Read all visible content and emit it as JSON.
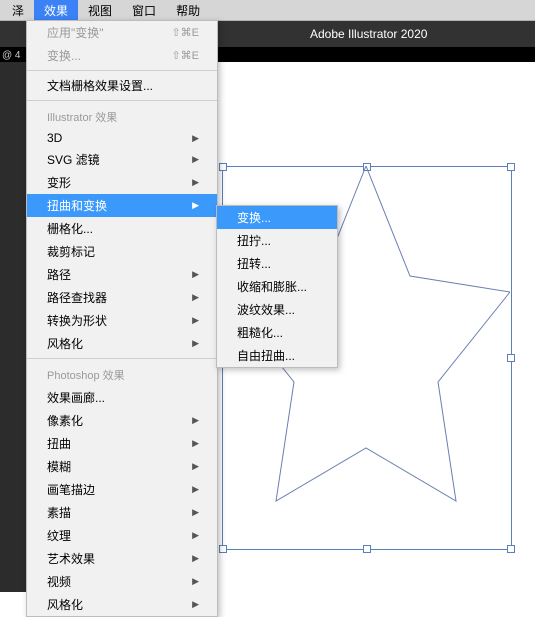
{
  "menubar": {
    "items": [
      "泽",
      "效果",
      "视图",
      "窗口",
      "帮助"
    ],
    "activeIndex": 1
  },
  "appTitle": "Adobe Illustrator 2020",
  "darkStripText": "@ 4",
  "menu": {
    "apply": {
      "label": "应用\"变换\"",
      "shortcut": "⇧⌘E"
    },
    "reapply": {
      "label": "变换...",
      "shortcut": "⇧⌘E"
    },
    "docRaster": "文档栅格效果设置...",
    "section1": "Illustrator 效果",
    "items1": [
      "3D",
      "SVG 滤镜",
      "变形",
      "扭曲和变换",
      "栅格化...",
      "裁剪标记",
      "路径",
      "路径查找器",
      "转换为形状",
      "风格化"
    ],
    "section2": "Photoshop 效果",
    "items2": [
      "效果画廊...",
      "像素化",
      "扭曲",
      "模糊",
      "画笔描边",
      "素描",
      "纹理",
      "艺术效果",
      "视频",
      "风格化"
    ],
    "arrows1": [
      true,
      true,
      true,
      true,
      false,
      false,
      true,
      true,
      true,
      true
    ],
    "arrows2": [
      false,
      true,
      true,
      true,
      true,
      true,
      true,
      true,
      true,
      true
    ],
    "highlightIndex": 3
  },
  "submenu": {
    "items": [
      "变换...",
      "扭拧...",
      "扭转...",
      "收缩和膨胀...",
      "波纹效果...",
      "粗糙化...",
      "自由扭曲..."
    ],
    "highlightIndex": 0
  }
}
